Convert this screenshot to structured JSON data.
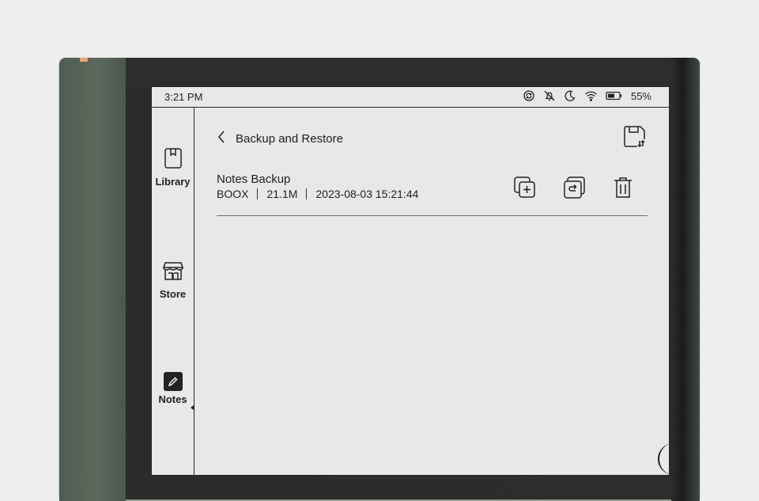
{
  "status_bar": {
    "time": "3:21 PM",
    "battery": "55%",
    "icons": [
      "sync-icon",
      "bell-off-icon",
      "moon-icon",
      "wifi-icon",
      "battery-icon"
    ]
  },
  "sidebar": {
    "items": [
      {
        "label": "Library",
        "icon": "book-icon"
      },
      {
        "label": "Store",
        "icon": "store-icon"
      },
      {
        "label": "Notes",
        "icon": "pen-icon",
        "active": true
      }
    ]
  },
  "page": {
    "title": "Backup and Restore",
    "back_icon": "chevron-left-icon",
    "header_action_icon": "save-restore-icon"
  },
  "backup": {
    "name": "Notes Backup",
    "source": "BOOX",
    "size": "21.1M",
    "date": "2023-08-03 15:21:44",
    "actions": [
      "copy-add-icon",
      "restore-icon",
      "trash-icon"
    ]
  },
  "colors": {
    "screen_bg": "#e8e8e8",
    "device_green": "#566558",
    "led": "#f0a46b"
  }
}
